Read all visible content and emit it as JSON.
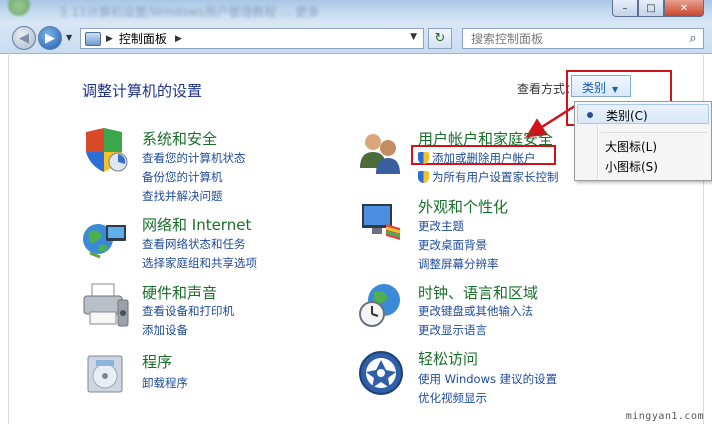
{
  "window": {
    "blurred_title": "5 11计算机设置/Windows用户管理教程 ... 更多",
    "minimize": "–",
    "maximize": "□",
    "close": "✕"
  },
  "nav": {
    "breadcrumb": "控制面板",
    "search_placeholder": "搜索控制面板"
  },
  "page": {
    "title": "调整计算机的设置",
    "view_by_label": "查看方式：",
    "view_by_value": "类别"
  },
  "view_menu": {
    "items": [
      "类别(C)",
      "大图标(L)",
      "小图标(S)"
    ]
  },
  "categories": [
    {
      "title": "系统和安全",
      "links": [
        "查看您的计算机状态",
        "备份您的计算机",
        "查找并解决问题"
      ]
    },
    {
      "title": "网络和 Internet",
      "links": [
        "查看网络状态和任务",
        "选择家庭组和共享选项"
      ]
    },
    {
      "title": "硬件和声音",
      "links": [
        "查看设备和打印机",
        "添加设备"
      ]
    },
    {
      "title": "程序",
      "links": [
        "卸载程序"
      ]
    },
    {
      "title": "用户帐户和家庭安全",
      "links": [
        "添加或删除用户帐户",
        "为所有用户设置家长控制"
      ]
    },
    {
      "title": "外观和个性化",
      "links": [
        "更改主题",
        "更改桌面背景",
        "调整屏幕分辨率"
      ]
    },
    {
      "title": "时钟、语言和区域",
      "links": [
        "更改键盘或其他输入法",
        "更改显示语言"
      ]
    },
    {
      "title": "轻松访问",
      "links": [
        "使用 Windows 建议的设置",
        "优化视频显示"
      ]
    }
  ],
  "watermark": "mingyan1.com",
  "colors": {
    "highlight": "#d1121b",
    "category_title": "#1a6e2b",
    "link": "#1f4b99",
    "page_title": "#1e3287"
  }
}
